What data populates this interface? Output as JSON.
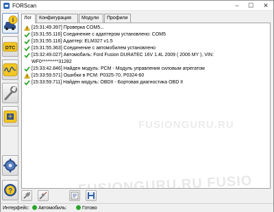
{
  "window": {
    "title": "FORScan",
    "min_label": "–",
    "max_label": "☐",
    "close_label": "✕"
  },
  "sidebar": {
    "items": [
      {
        "name": "info",
        "icon": "info-car-icon"
      },
      {
        "name": "dtc",
        "icon": "dtc-icon"
      },
      {
        "name": "oscilloscope",
        "icon": "oscilloscope-icon"
      },
      {
        "name": "tests",
        "icon": "wrench-icon"
      },
      {
        "name": "programming",
        "icon": "chip-icon"
      },
      {
        "name": "settings",
        "icon": "gear-icon"
      },
      {
        "name": "help",
        "icon": "help-icon"
      }
    ]
  },
  "tabs": [
    {
      "label": "Лог"
    },
    {
      "label": "Конфигурация"
    },
    {
      "label": "Модули"
    },
    {
      "label": "Профили"
    }
  ],
  "log": {
    "entries": [
      {
        "type": "warning",
        "text": "[15:31:49.397] Проверка COM5..."
      },
      {
        "type": "ok",
        "text": "[15:31:55.116] Соединение с адаптером установлено: COM5"
      },
      {
        "type": "ok",
        "text": "[15:31:55.116] Адаптер:  ELM327 v1.5"
      },
      {
        "type": "ok",
        "text": "[15:31:55.363] Соединение с автомобилем установлено"
      },
      {
        "type": "ok",
        "text": "[15:32:49.027] Автомобиль: Ford Fusion DURATEC 16V 1.4L 2009 ( 2006 MY ), VIN: WF0*********31282"
      },
      {
        "type": "ok",
        "text": "[15:33:42.846] Найден модуль:  PCM - Модуль управления силовым агрегатом"
      },
      {
        "type": "warning",
        "text": "[15:33:59.571] Ошибки в PCM: P0325-70, P0324-60"
      },
      {
        "type": "ok",
        "text": "[15:33:59.711] Найден модуль:  OBDII - Бортовая диагностика OBD II"
      }
    ]
  },
  "watermark": {
    "text": "FUSIONGURU.RU",
    "text_b": "FUSIONGURU.RU   FUSIO"
  },
  "toolbar": {
    "buttons": [
      {
        "name": "connect",
        "icon": "plug-icon"
      },
      {
        "name": "disconnect",
        "icon": "unplug-icon"
      },
      {
        "name": "clear",
        "icon": "clear-icon"
      },
      {
        "name": "save",
        "icon": "floppy-icon"
      }
    ]
  },
  "status": {
    "interface_label": "Интерфейс:",
    "car_label": "Автомобиль:",
    "ready_label": "Готово",
    "ok_color": "#2aa52a"
  }
}
